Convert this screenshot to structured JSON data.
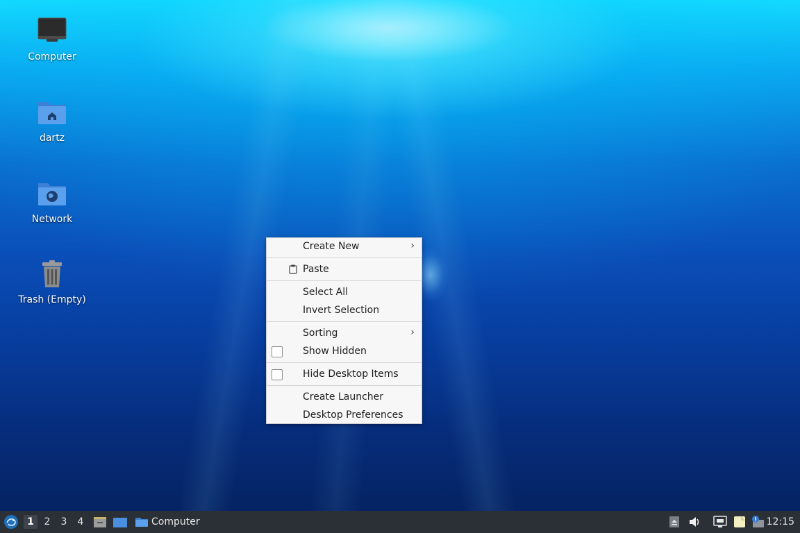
{
  "desktop": {
    "icons": [
      {
        "label": "Computer",
        "icon": "computer-icon"
      },
      {
        "label": "dartz",
        "icon": "home-folder-icon"
      },
      {
        "label": "Network",
        "icon": "network-folder-icon"
      },
      {
        "label": "Trash (Empty)",
        "icon": "trash-icon"
      }
    ]
  },
  "context_menu": {
    "create_new": "Create New",
    "paste": "Paste",
    "select_all": "Select All",
    "invert_selection": "Invert Selection",
    "sorting": "Sorting",
    "show_hidden": "Show Hidden",
    "hide_desktop_items": "Hide Desktop Items",
    "create_launcher": "Create Launcher",
    "desktop_preferences": "Desktop Preferences"
  },
  "taskbar": {
    "workspaces": [
      "1",
      "2",
      "3",
      "4"
    ],
    "active_workspace": "1",
    "window_button_label": "Computer",
    "clock": "12:15"
  },
  "colors": {
    "taskbar_bg": "#2b3036",
    "menu_bg": "#f7f7f7",
    "folder_blue": "#4a8fe0"
  }
}
